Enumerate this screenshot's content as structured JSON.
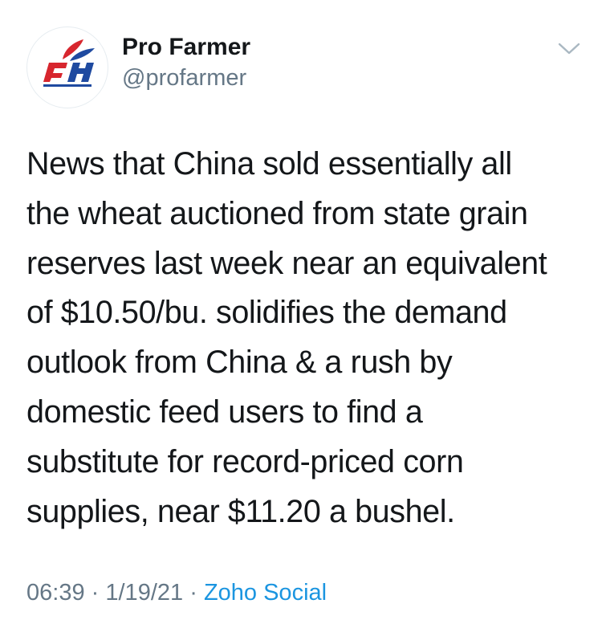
{
  "author": {
    "name": "Pro Farmer",
    "handle": "@profarmer"
  },
  "icons": {
    "avatar": "pro-farmer-logo",
    "menu": "chevron-down-icon"
  },
  "tweet": {
    "text": "News that China sold essentially all\nthe wheat auctioned from state grain\nreserves last week near an equivalent\nof $10.50/bu. solidifies the demand\noutlook from China & a rush by\ndomestic feed users to find a\nsubstitute for record-priced corn\nsupplies, near $11.20 a bushel."
  },
  "meta": {
    "time": "06:39",
    "separator": "·",
    "date": "1/19/21",
    "source": "Zoho Social"
  },
  "colors": {
    "text": "#14171a",
    "secondary": "#657786",
    "link": "#1b95e0",
    "logo_red": "#d7262e",
    "logo_blue": "#1f4aa0"
  }
}
